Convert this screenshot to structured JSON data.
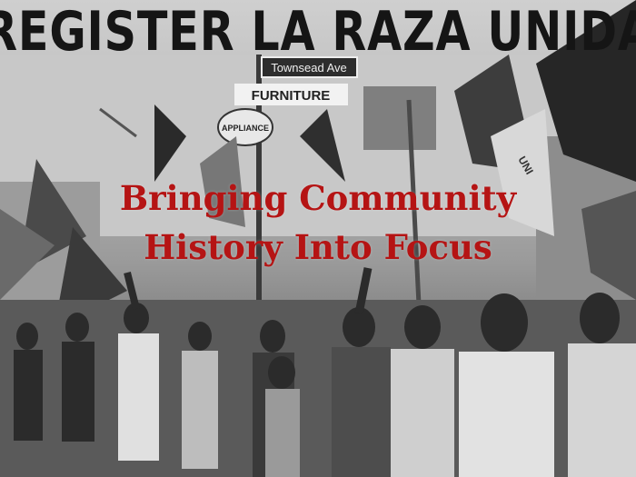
{
  "headline": "REGISTER LA RAZA UNIDA",
  "overlay": {
    "line1": "Bringing Community",
    "line2": "History Into Focus"
  },
  "signs": {
    "street": "Townsead Ave",
    "store": "FURNITURE",
    "appliance": "APPLIANCE",
    "flag_text": "UNI"
  },
  "colors": {
    "overlay_text": "#b51414",
    "headline": "#151515"
  }
}
